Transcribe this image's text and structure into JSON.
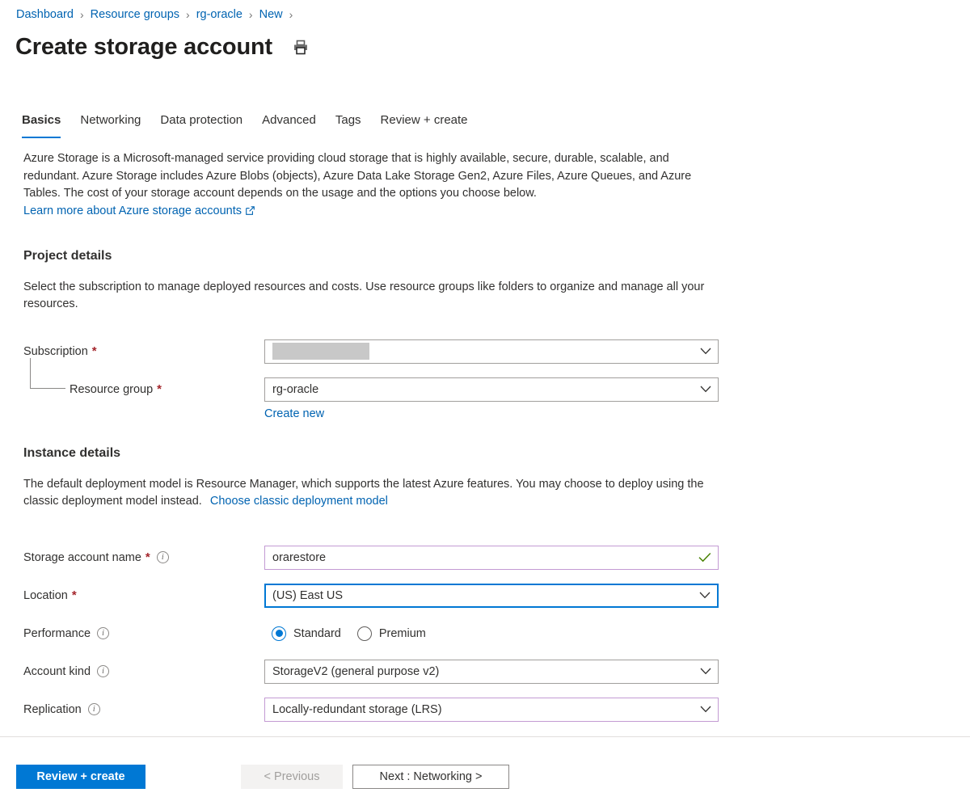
{
  "breadcrumb": {
    "items": [
      "Dashboard",
      "Resource groups",
      "rg-oracle",
      "New"
    ],
    "separator": "›"
  },
  "header": {
    "title": "Create storage account",
    "print_icon": "printer-icon"
  },
  "tabs": [
    {
      "label": "Basics",
      "active": true
    },
    {
      "label": "Networking",
      "active": false
    },
    {
      "label": "Data protection",
      "active": false
    },
    {
      "label": "Advanced",
      "active": false
    },
    {
      "label": "Tags",
      "active": false
    },
    {
      "label": "Review + create",
      "active": false
    }
  ],
  "intro": {
    "paragraph": "Azure Storage is a Microsoft-managed service providing cloud storage that is highly available, secure, durable, scalable, and redundant. Azure Storage includes Azure Blobs (objects), Azure Data Lake Storage Gen2, Azure Files, Azure Queues, and Azure Tables. The cost of your storage account depends on the usage and the options you choose below.",
    "learn_more_link": "Learn more about Azure storage accounts",
    "learn_more_icon": "external-link-icon"
  },
  "project_details": {
    "heading": "Project details",
    "description": "Select the subscription to manage deployed resources and costs. Use resource groups like folders to organize and manage all your resources.",
    "subscription": {
      "label": "Subscription",
      "required": "*",
      "value": "",
      "redacted": true
    },
    "resource_group": {
      "label": "Resource group",
      "required": "*",
      "value": "rg-oracle",
      "create_new_link": "Create new"
    }
  },
  "instance_details": {
    "heading": "Instance details",
    "description": "The default deployment model is Resource Manager, which supports the latest Azure features. You may choose to deploy using the classic deployment model instead.",
    "classic_link": "Choose classic deployment model",
    "storage_account_name": {
      "label": "Storage account name",
      "required": "*",
      "value": "orarestore",
      "validation": "valid",
      "validation_icon": "checkmark-icon"
    },
    "location": {
      "label": "Location",
      "required": "*",
      "value": "(US) East US",
      "focused": true
    },
    "performance": {
      "label": "Performance",
      "options": [
        {
          "label": "Standard",
          "selected": true
        },
        {
          "label": "Premium",
          "selected": false
        }
      ]
    },
    "account_kind": {
      "label": "Account kind",
      "value": "StorageV2 (general purpose v2)"
    },
    "replication": {
      "label": "Replication",
      "value": "Locally-redundant storage (LRS)"
    }
  },
  "footer": {
    "review_create": "Review + create",
    "previous": "< Previous",
    "next": "Next : Networking >"
  },
  "colors": {
    "accent": "#0078d4",
    "link": "#0063b1",
    "required": "#a4262c",
    "validated_border": "#c39bd3",
    "success": "#498205",
    "redaction": "#c8c8c8"
  }
}
